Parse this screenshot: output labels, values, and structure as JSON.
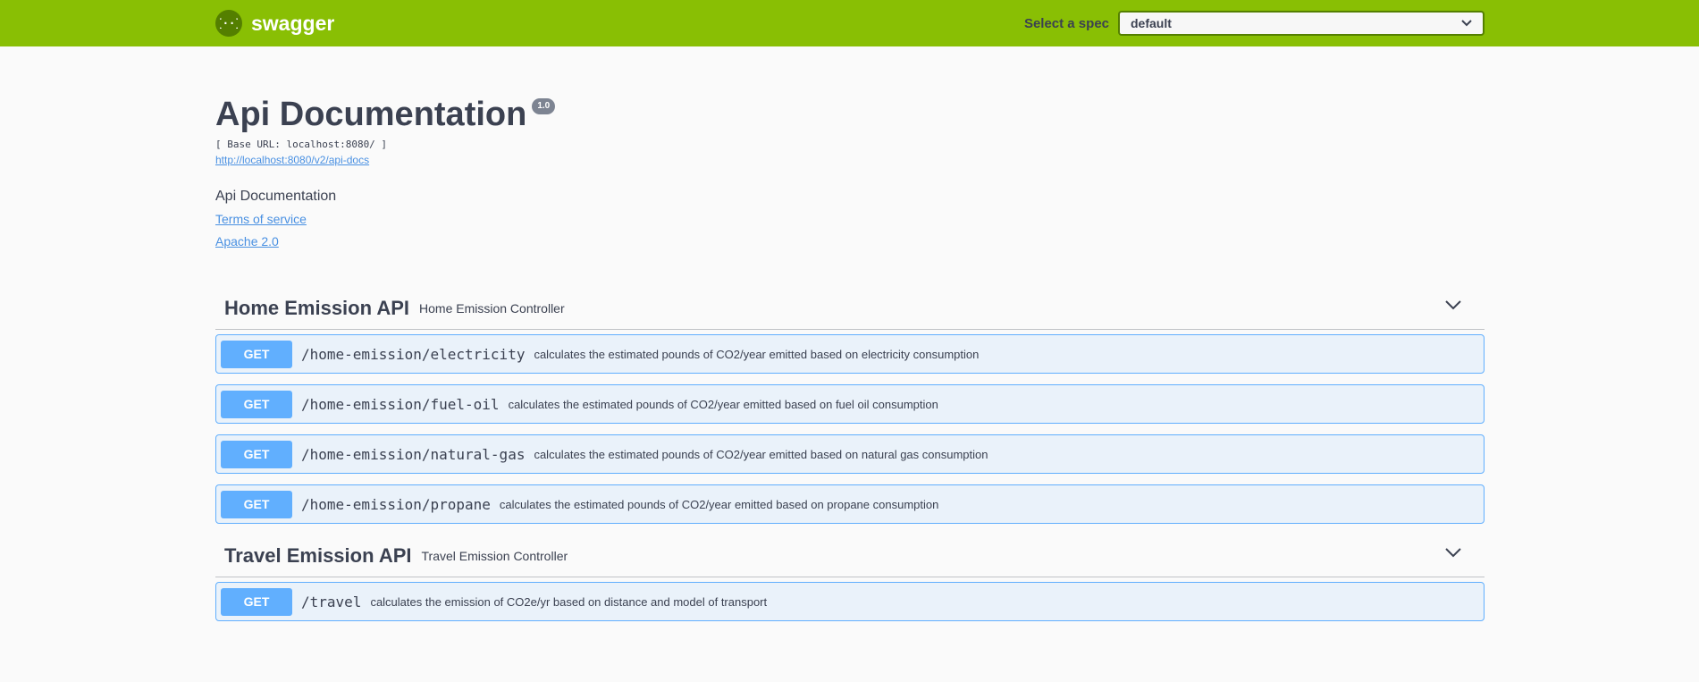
{
  "topbar": {
    "brand": "swagger",
    "spec_label": "Select a spec",
    "spec_value": "default"
  },
  "info": {
    "title": "Api Documentation",
    "version": "1.0",
    "base_url": "[ Base URL: localhost:8080/ ]",
    "docs_url": "http://localhost:8080/v2/api-docs",
    "description": "Api Documentation",
    "terms": "Terms of service",
    "license": "Apache 2.0"
  },
  "tags": [
    {
      "name": "Home Emission API",
      "description": "Home Emission Controller",
      "operations": [
        {
          "method": "GET",
          "path": "/home-emission/electricity",
          "summary": "calculates the estimated pounds of CO2/year emitted based on electricity consumption"
        },
        {
          "method": "GET",
          "path": "/home-emission/fuel-oil",
          "summary": "calculates the estimated pounds of CO2/year emitted based on fuel oil consumption"
        },
        {
          "method": "GET",
          "path": "/home-emission/natural-gas",
          "summary": "calculates the estimated pounds of CO2/year emitted based on natural gas consumption"
        },
        {
          "method": "GET",
          "path": "/home-emission/propane",
          "summary": "calculates the estimated pounds of CO2/year emitted based on propane consumption"
        }
      ]
    },
    {
      "name": "Travel Emission API",
      "description": "Travel Emission Controller",
      "operations": [
        {
          "method": "GET",
          "path": "/travel",
          "summary": "calculates the emission of CO2e/yr based on distance and model of transport"
        }
      ]
    }
  ],
  "colors": {
    "topbar": "#89bf04",
    "get": "#61affe",
    "link": "#4990e2"
  }
}
